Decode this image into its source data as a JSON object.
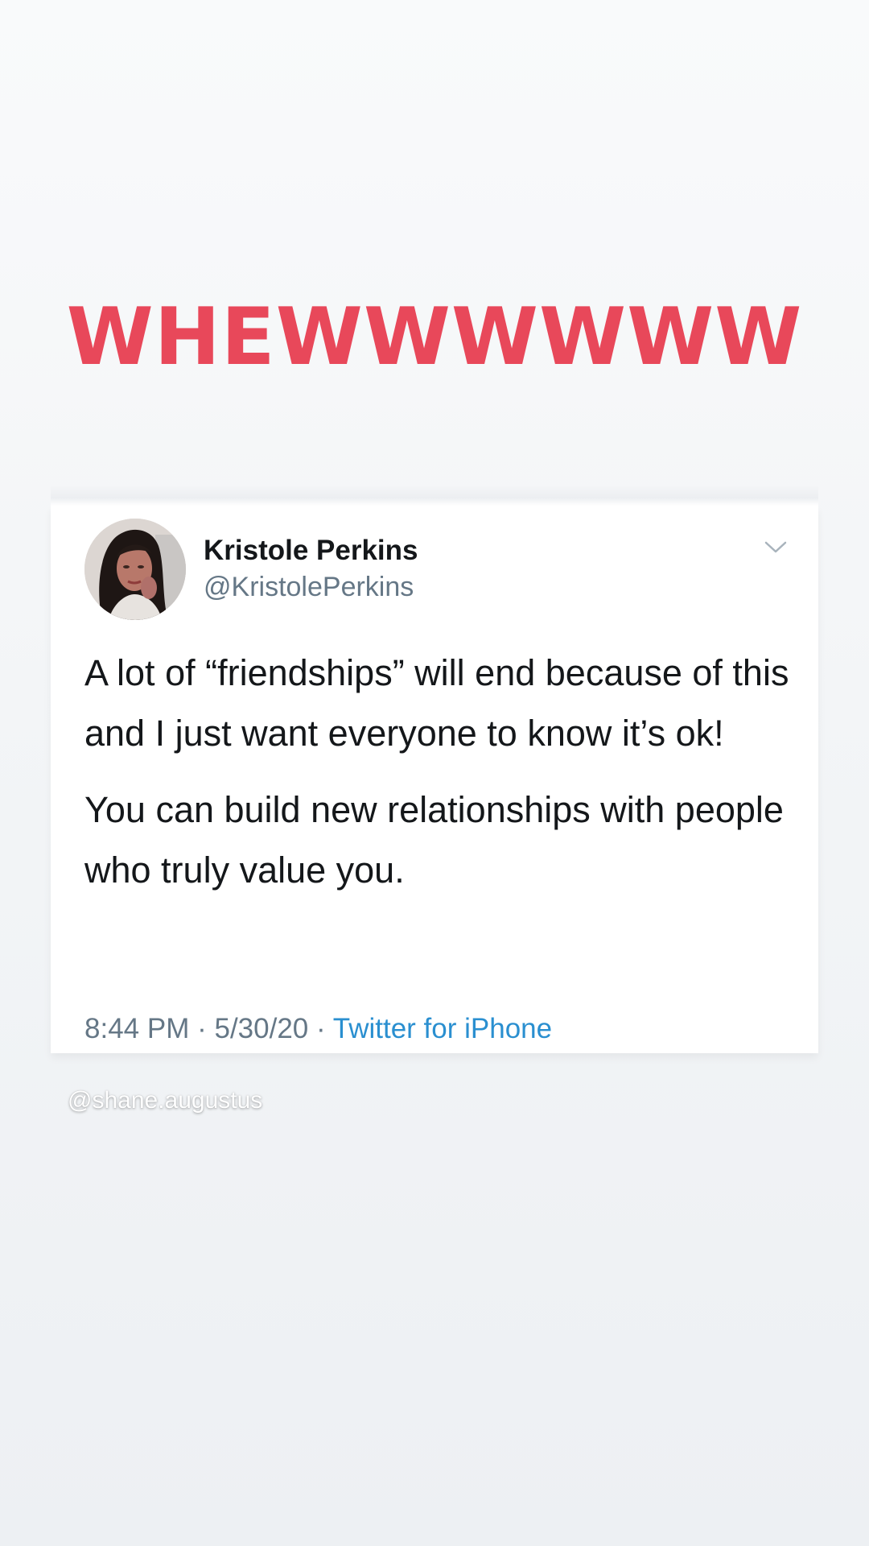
{
  "story": {
    "headline": "WHEWWWWWW",
    "watermark": "@shane.augustus"
  },
  "tweet": {
    "display_name": "Kristole Perkins",
    "handle": "@KristolePerkins",
    "menu_icon": "chevron-down-icon",
    "paragraphs": [
      "A lot of “friendships” will end because of this and I just want everyone to know it’s ok!",
      "You can build new relationships with people who truly value you."
    ],
    "time": "8:44 PM",
    "date": "5/30/20",
    "separator": "·",
    "source": "Twitter for iPhone"
  },
  "colors": {
    "headline": "#e8485a",
    "text_primary": "#14171a",
    "text_secondary": "#657786",
    "link": "#2a8fd0"
  }
}
